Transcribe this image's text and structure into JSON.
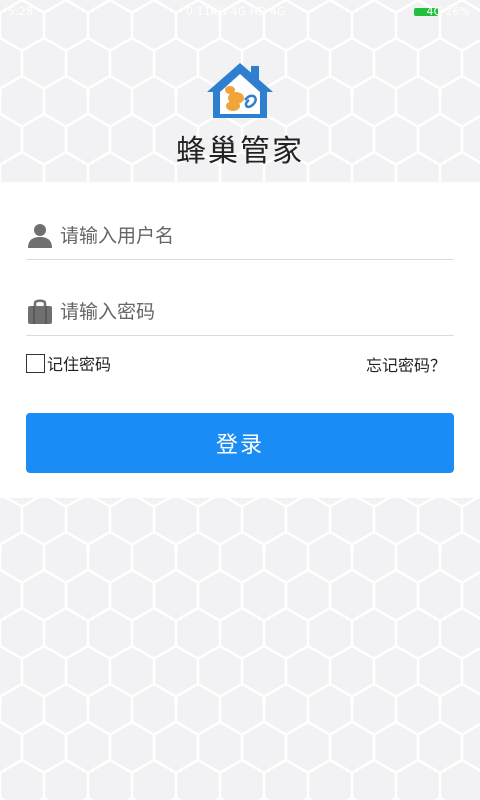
{
  "status_bar": {
    "time": "5:28",
    "center": "0.11K/s 4G HD 4G",
    "right": "4G 26%"
  },
  "app": {
    "name": "蜂巢管家"
  },
  "login_form": {
    "username_placeholder": "请输入用户名",
    "password_placeholder": "请输入密码",
    "remember_label": "记住密码",
    "remember_checked": false,
    "forgot_label": "忘记密码？",
    "login_label": "登录"
  },
  "colors": {
    "accent": "#1a8cf5",
    "logo_blue": "#2f7fd0",
    "logo_orange": "#f0a43a",
    "battery": "#22c03c"
  },
  "icons": {
    "username": "user-icon",
    "password": "lock-icon",
    "logo": "house-bee-icon"
  }
}
